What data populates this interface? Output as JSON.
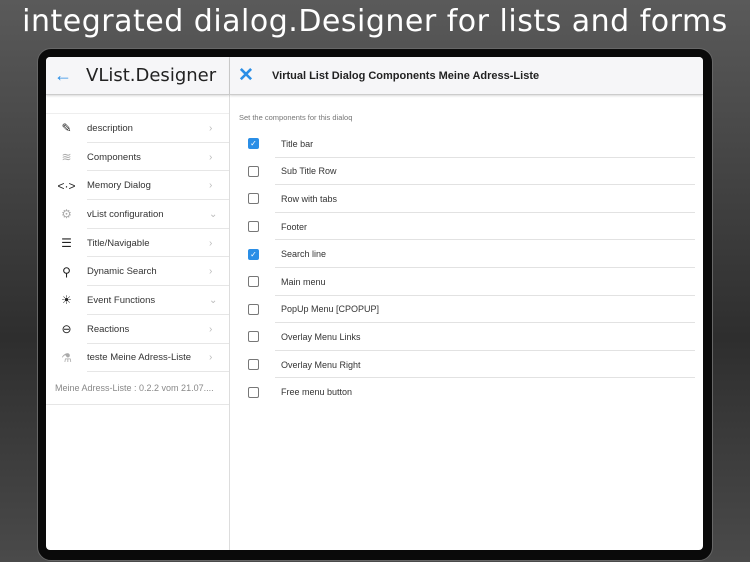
{
  "headline": "integrated dialog.Designer for lists and forms",
  "sidebar": {
    "title": "VList.Designer",
    "items": [
      {
        "label": "description",
        "icon": "pencil-icon",
        "glyph": "✎",
        "chev": "›"
      },
      {
        "label": "Components",
        "icon": "layers-icon",
        "glyph": "≋",
        "chev": "›"
      },
      {
        "label": "Memory Dialog",
        "icon": "code-icon",
        "glyph": "<·>",
        "chev": "›"
      },
      {
        "label": "vList configuration",
        "icon": "gear-icon",
        "glyph": "⚙",
        "chev": "⌄"
      },
      {
        "label": "Title/Navigable",
        "icon": "menu-icon",
        "glyph": "☰",
        "chev": "›"
      },
      {
        "label": "Dynamic Search",
        "icon": "search-icon",
        "glyph": "⚲",
        "chev": "›"
      },
      {
        "label": "Event Functions",
        "icon": "lightbulb-icon",
        "glyph": "☀",
        "chev": "⌄"
      },
      {
        "label": "Reactions",
        "icon": "login-icon",
        "glyph": "⊖",
        "chev": "›"
      },
      {
        "label": "teste Meine Adress-Liste",
        "icon": "test-icon",
        "glyph": "⚗",
        "chev": "›"
      }
    ],
    "footer": "Meine Adress-Liste : 0.2.2 vom 21.07...."
  },
  "main": {
    "title": "Virtual List Dialog Components Meine Adress-Liste",
    "hint": "Set the components for this dialoq",
    "options": [
      {
        "label": "Title bar",
        "checked": true
      },
      {
        "label": "Sub Title Row",
        "checked": false
      },
      {
        "label": "Row with tabs",
        "checked": false
      },
      {
        "label": "Footer",
        "checked": false
      },
      {
        "label": "Search line",
        "checked": true
      },
      {
        "label": "Main menu",
        "checked": false
      },
      {
        "label": "PopUp Menu [CPOPUP]",
        "checked": false
      },
      {
        "label": "Overlay Menu Links",
        "checked": false
      },
      {
        "label": "Overlay Menu Right",
        "checked": false
      },
      {
        "label": "Free menu button",
        "checked": false
      }
    ]
  },
  "colors": {
    "accent": "#2a8ee6"
  }
}
